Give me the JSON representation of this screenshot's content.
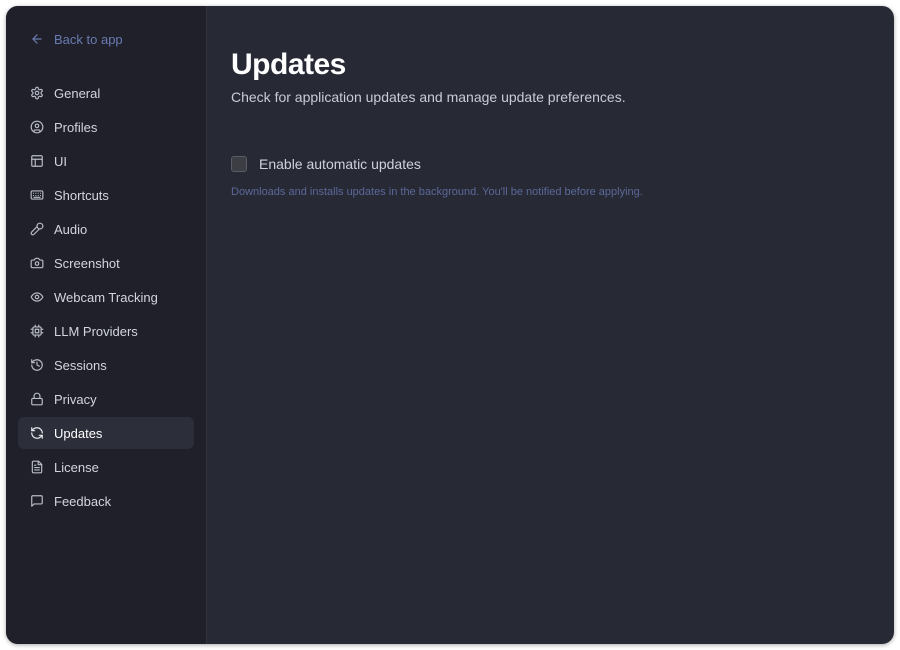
{
  "sidebar": {
    "back_label": "Back to app",
    "items": [
      {
        "label": "General",
        "icon": "gear-icon"
      },
      {
        "label": "Profiles",
        "icon": "user-circle-icon"
      },
      {
        "label": "UI",
        "icon": "layout-icon"
      },
      {
        "label": "Shortcuts",
        "icon": "keyboard-icon"
      },
      {
        "label": "Audio",
        "icon": "microphone-icon"
      },
      {
        "label": "Screenshot",
        "icon": "camera-icon"
      },
      {
        "label": "Webcam Tracking",
        "icon": "eye-icon"
      },
      {
        "label": "LLM Providers",
        "icon": "cpu-chip-icon"
      },
      {
        "label": "Sessions",
        "icon": "history-icon"
      },
      {
        "label": "Privacy",
        "icon": "lock-icon"
      },
      {
        "label": "Updates",
        "icon": "refresh-icon"
      },
      {
        "label": "License",
        "icon": "document-icon"
      },
      {
        "label": "Feedback",
        "icon": "message-icon"
      }
    ],
    "active_item": "Updates"
  },
  "main": {
    "title": "Updates",
    "subtitle": "Check for application updates and manage update preferences.",
    "auto_update": {
      "label": "Enable automatic updates",
      "checked": false,
      "hint": "Downloads and installs updates in the background. You'll be notified before applying."
    }
  },
  "colors": {
    "window_bg": "#272a35",
    "sidebar_bg": "#1f2029",
    "active_item_bg": "#2c2e39",
    "link_color": "#6a7bb2",
    "hint_color": "#5b6899"
  }
}
